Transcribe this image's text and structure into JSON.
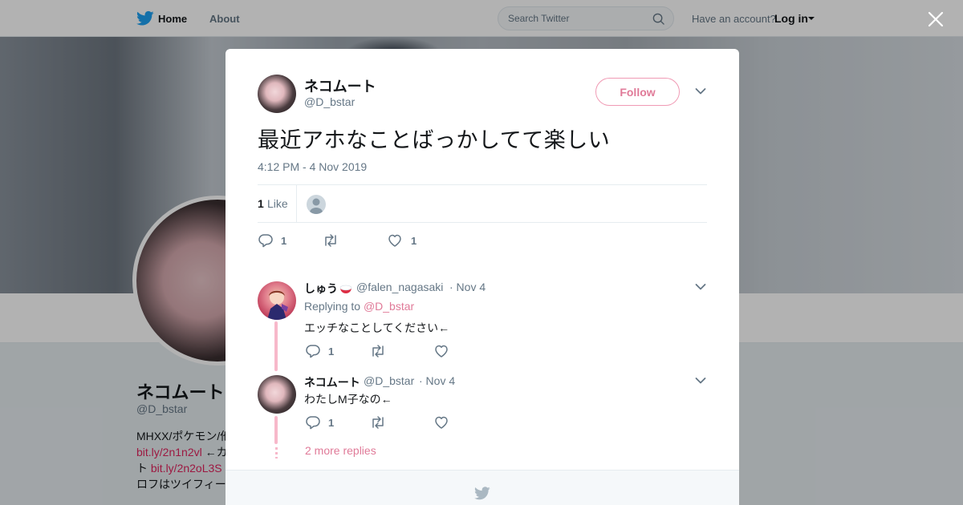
{
  "topbar": {
    "nav_home": "Home",
    "nav_about": "About",
    "search_placeholder": "Search Twitter",
    "account_prompt": "Have an account?",
    "login": "Log in"
  },
  "profile_bg": {
    "name": "ネコムート",
    "handle": "@D_bstar",
    "bio_line1": "MHXX/ポケモン/他",
    "bio_link1": "bit.ly/2n1n2vl",
    "bio_line2_suffix": " ←カ",
    "bio_line3_prefix": "ト ",
    "bio_link2": "bit.ly/2n2oL3S",
    "bio_line4": "ロフはツイフィー"
  },
  "tweet": {
    "author_name": "ネコムート",
    "author_handle": "@D_bstar",
    "follow_label": "Follow",
    "text": "最近アホなことばっかしてて楽しい",
    "timestamp": "4:12 PM - 4 Nov 2019",
    "like_count": "1",
    "like_label": "Like",
    "actions": {
      "reply_count": "1",
      "retweet_count": "",
      "like_count": "1"
    }
  },
  "replies": [
    {
      "name": "しゅう",
      "handle": "@falen_nagasaki",
      "date": "· Nov 4",
      "replying_prefix": "Replying to ",
      "replying_to": "@D_bstar",
      "text": "エッチなことしてください←",
      "reply_count": "1",
      "retweet_count": "",
      "like_count": ""
    },
    {
      "name": "ネコムート",
      "handle": "@D_bstar",
      "date": "· Nov 4",
      "text": "わたしM子なの←",
      "reply_count": "1",
      "retweet_count": "",
      "like_count": ""
    }
  ],
  "more_replies": "2 more replies",
  "colors": {
    "accent": "#e0245e",
    "link_pink": "#e07a98",
    "thread_line": "#f7b8ca",
    "twitter_blue": "#1da1f2"
  },
  "icons": [
    "twitter-bird-icon",
    "search-icon",
    "close-icon",
    "chevron-down-icon",
    "reply-icon",
    "retweet-icon",
    "heart-icon"
  ]
}
